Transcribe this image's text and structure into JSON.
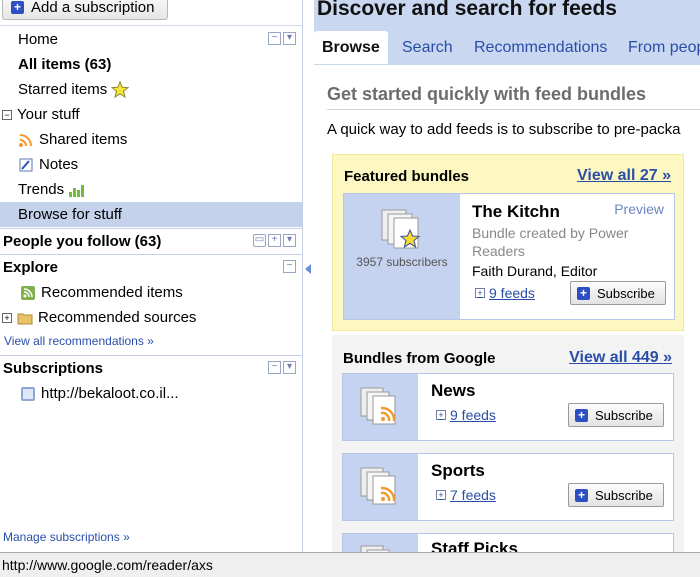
{
  "sidebar": {
    "add_subscription": "Add a subscription",
    "home": "Home",
    "all_items": "All items (63)",
    "starred_items": "Starred items",
    "your_stuff": "Your stuff",
    "shared_items": "Shared items",
    "notes": "Notes",
    "trends": "Trends",
    "browse_for_stuff": "Browse for stuff",
    "people_you_follow": "People you follow (63)",
    "explore": "Explore",
    "recommended_items": "Recommended items",
    "recommended_sources": "Recommended sources",
    "view_all_recommendations": "View all recommendations »",
    "subscriptions": "Subscriptions",
    "subscription_item": "http://bekaloot.co.il...",
    "manage_subscriptions": "Manage subscriptions »"
  },
  "main": {
    "title": "Discover and search for feeds",
    "tabs": [
      "Browse",
      "Search",
      "Recommendations",
      "From peop"
    ],
    "get_started": "Get started quickly with feed bundles",
    "intro": "A quick way to add feeds is to subscribe to pre-packa",
    "featured": {
      "heading": "Featured bundles",
      "view_all": "View all 27 »",
      "subscribers": "3957 subscribers",
      "title": "The Kitchn",
      "preview": "Preview",
      "created_by": "Bundle created by Power Readers",
      "author": "Faith Durand, Editor",
      "feeds": "9 feeds",
      "subscribe": "Subscribe"
    },
    "google": {
      "heading": "Bundles from Google",
      "view_all": "View all 449 »",
      "bundles": [
        {
          "title": "News",
          "feeds": "9 feeds",
          "subscribe": "Subscribe"
        },
        {
          "title": "Sports",
          "feeds": "7 feeds",
          "subscribe": "Subscribe"
        },
        {
          "title": "Staff Picks"
        }
      ]
    }
  },
  "statusbar": {
    "url": "http://www.google.com/reader/axs"
  },
  "colors": {
    "accent": "#2a4ea8",
    "header": "#c9d7f1",
    "selected": "#c5d2ec",
    "featured_bg": "#fdf8c2"
  }
}
